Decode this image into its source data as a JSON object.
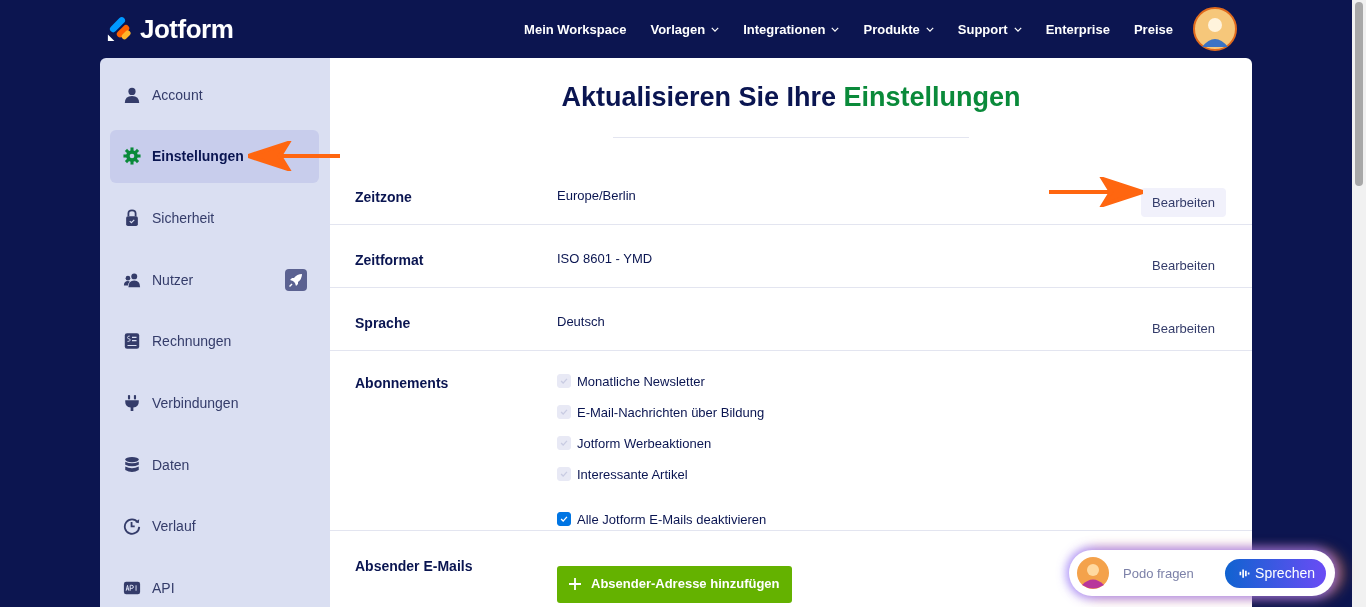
{
  "brand": {
    "name": "Jotform"
  },
  "nav": [
    {
      "label": "Mein Workspace",
      "dropdown": false
    },
    {
      "label": "Vorlagen",
      "dropdown": true
    },
    {
      "label": "Integrationen",
      "dropdown": true
    },
    {
      "label": "Produkte",
      "dropdown": true
    },
    {
      "label": "Support",
      "dropdown": true
    },
    {
      "label": "Enterprise",
      "dropdown": false
    },
    {
      "label": "Preise",
      "dropdown": false
    }
  ],
  "sidebar": {
    "items": [
      {
        "label": "Account",
        "kind": "person",
        "selected": false,
        "badge": false
      },
      {
        "label": "Einstellungen",
        "kind": "gear",
        "selected": true,
        "badge": false
      },
      {
        "label": "Sicherheit",
        "kind": "lock",
        "selected": false,
        "badge": false
      },
      {
        "label": "Nutzer",
        "kind": "people",
        "selected": false,
        "badge": true
      },
      {
        "label": "Rechnungen",
        "kind": "invoice",
        "selected": false,
        "badge": false
      },
      {
        "label": "Verbindungen",
        "kind": "plug",
        "selected": false,
        "badge": false
      },
      {
        "label": "Daten",
        "kind": "database",
        "selected": false,
        "badge": false
      },
      {
        "label": "Verlauf",
        "kind": "history",
        "selected": false,
        "badge": false
      },
      {
        "label": "API",
        "kind": "api",
        "selected": false,
        "badge": false
      }
    ]
  },
  "title": {
    "start": "Aktualisieren Sie Ihre",
    "highlight": "Einstellungen"
  },
  "settings": [
    {
      "label": "Zeitzone",
      "value": "Europe/Berlin",
      "button": "Bearbeiten",
      "highlighted": true
    },
    {
      "label": "Zeitformat",
      "value": "ISO 8601 - YMD",
      "button": "Bearbeiten",
      "highlighted": false
    },
    {
      "label": "Sprache",
      "value": "Deutsch",
      "button": "Bearbeiten",
      "highlighted": false
    }
  ],
  "subscriptions": {
    "label": "Abonnements",
    "options": [
      {
        "label": "Monatliche Newsletter",
        "checked": true,
        "disabled": true
      },
      {
        "label": "E-Mail-Nachrichten über Bildung",
        "checked": true,
        "disabled": true
      },
      {
        "label": "Jotform Werbeaktionen",
        "checked": true,
        "disabled": true
      },
      {
        "label": "Interessante Artikel",
        "checked": true,
        "disabled": true
      }
    ],
    "master": {
      "label": "Alle Jotform E-Mails deaktivieren",
      "checked": true,
      "disabled": false
    }
  },
  "sender": {
    "label": "Absender E-Mails",
    "button": "Absender-Adresse hinzufügen"
  },
  "assistant": {
    "placeholder": "Podo fragen",
    "button": "Sprechen"
  }
}
